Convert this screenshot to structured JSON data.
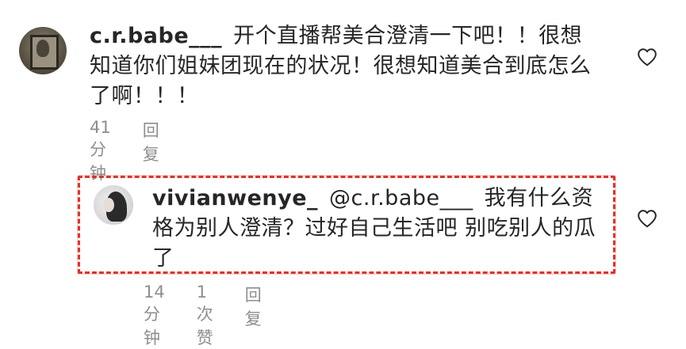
{
  "comments": [
    {
      "username": "c.r.babe___",
      "text": "开个直播帮美合澄清一下吧！！很想知道你们姐妹团现在的状况！很想知道美合到底怎么了啊！！！",
      "time": "41分钟",
      "reply_label": "回复"
    },
    {
      "username": "vivianwenye_",
      "mention": "@c.r.babe___",
      "text": "我有什么资格为别人澄清？过好自己生活吧 别吃别人的瓜了",
      "time": "14分钟",
      "likes": "1 次赞",
      "reply_label": "回复"
    }
  ],
  "icons": {
    "like": "heart-outline-icon"
  },
  "colors": {
    "text": "#262626",
    "meta": "#8e8e8e",
    "highlight_border": "#e0332a"
  }
}
